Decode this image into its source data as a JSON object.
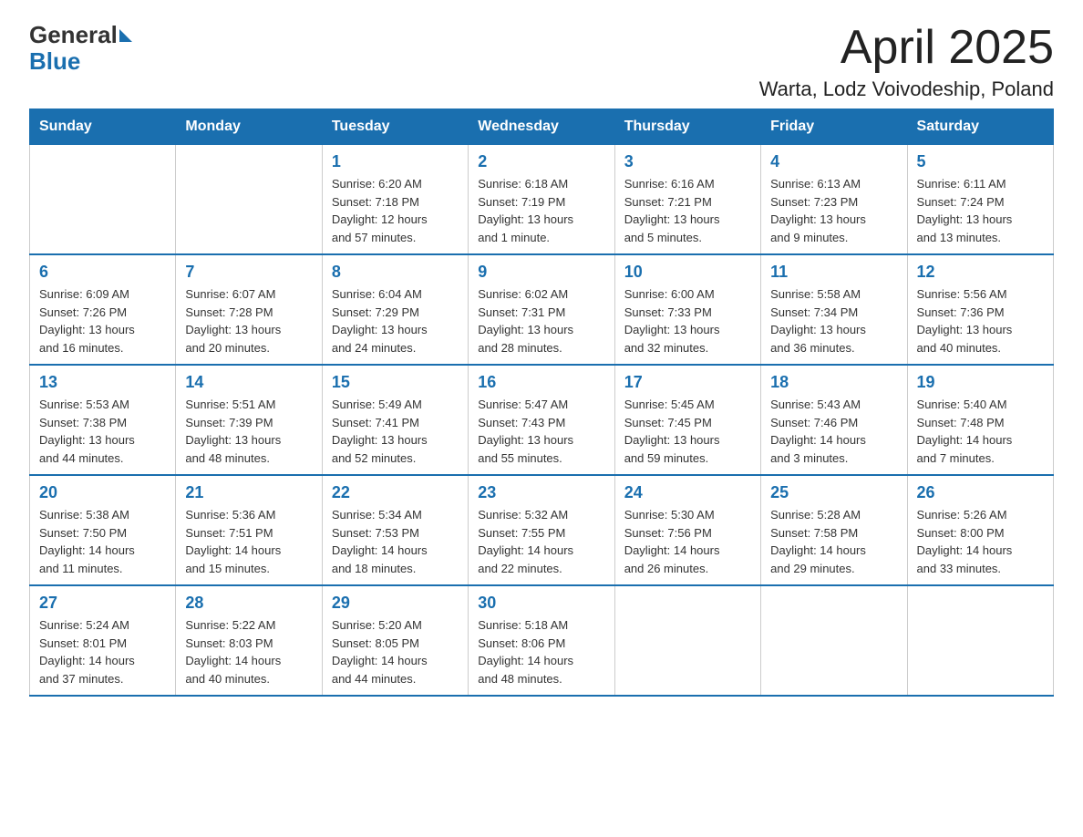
{
  "header": {
    "logo_general": "General",
    "logo_blue": "Blue",
    "title": "April 2025",
    "subtitle": "Warta, Lodz Voivodeship, Poland"
  },
  "weekdays": [
    "Sunday",
    "Monday",
    "Tuesday",
    "Wednesday",
    "Thursday",
    "Friday",
    "Saturday"
  ],
  "weeks": [
    [
      {
        "day": "",
        "info": ""
      },
      {
        "day": "",
        "info": ""
      },
      {
        "day": "1",
        "info": "Sunrise: 6:20 AM\nSunset: 7:18 PM\nDaylight: 12 hours\nand 57 minutes."
      },
      {
        "day": "2",
        "info": "Sunrise: 6:18 AM\nSunset: 7:19 PM\nDaylight: 13 hours\nand 1 minute."
      },
      {
        "day": "3",
        "info": "Sunrise: 6:16 AM\nSunset: 7:21 PM\nDaylight: 13 hours\nand 5 minutes."
      },
      {
        "day": "4",
        "info": "Sunrise: 6:13 AM\nSunset: 7:23 PM\nDaylight: 13 hours\nand 9 minutes."
      },
      {
        "day": "5",
        "info": "Sunrise: 6:11 AM\nSunset: 7:24 PM\nDaylight: 13 hours\nand 13 minutes."
      }
    ],
    [
      {
        "day": "6",
        "info": "Sunrise: 6:09 AM\nSunset: 7:26 PM\nDaylight: 13 hours\nand 16 minutes."
      },
      {
        "day": "7",
        "info": "Sunrise: 6:07 AM\nSunset: 7:28 PM\nDaylight: 13 hours\nand 20 minutes."
      },
      {
        "day": "8",
        "info": "Sunrise: 6:04 AM\nSunset: 7:29 PM\nDaylight: 13 hours\nand 24 minutes."
      },
      {
        "day": "9",
        "info": "Sunrise: 6:02 AM\nSunset: 7:31 PM\nDaylight: 13 hours\nand 28 minutes."
      },
      {
        "day": "10",
        "info": "Sunrise: 6:00 AM\nSunset: 7:33 PM\nDaylight: 13 hours\nand 32 minutes."
      },
      {
        "day": "11",
        "info": "Sunrise: 5:58 AM\nSunset: 7:34 PM\nDaylight: 13 hours\nand 36 minutes."
      },
      {
        "day": "12",
        "info": "Sunrise: 5:56 AM\nSunset: 7:36 PM\nDaylight: 13 hours\nand 40 minutes."
      }
    ],
    [
      {
        "day": "13",
        "info": "Sunrise: 5:53 AM\nSunset: 7:38 PM\nDaylight: 13 hours\nand 44 minutes."
      },
      {
        "day": "14",
        "info": "Sunrise: 5:51 AM\nSunset: 7:39 PM\nDaylight: 13 hours\nand 48 minutes."
      },
      {
        "day": "15",
        "info": "Sunrise: 5:49 AM\nSunset: 7:41 PM\nDaylight: 13 hours\nand 52 minutes."
      },
      {
        "day": "16",
        "info": "Sunrise: 5:47 AM\nSunset: 7:43 PM\nDaylight: 13 hours\nand 55 minutes."
      },
      {
        "day": "17",
        "info": "Sunrise: 5:45 AM\nSunset: 7:45 PM\nDaylight: 13 hours\nand 59 minutes."
      },
      {
        "day": "18",
        "info": "Sunrise: 5:43 AM\nSunset: 7:46 PM\nDaylight: 14 hours\nand 3 minutes."
      },
      {
        "day": "19",
        "info": "Sunrise: 5:40 AM\nSunset: 7:48 PM\nDaylight: 14 hours\nand 7 minutes."
      }
    ],
    [
      {
        "day": "20",
        "info": "Sunrise: 5:38 AM\nSunset: 7:50 PM\nDaylight: 14 hours\nand 11 minutes."
      },
      {
        "day": "21",
        "info": "Sunrise: 5:36 AM\nSunset: 7:51 PM\nDaylight: 14 hours\nand 15 minutes."
      },
      {
        "day": "22",
        "info": "Sunrise: 5:34 AM\nSunset: 7:53 PM\nDaylight: 14 hours\nand 18 minutes."
      },
      {
        "day": "23",
        "info": "Sunrise: 5:32 AM\nSunset: 7:55 PM\nDaylight: 14 hours\nand 22 minutes."
      },
      {
        "day": "24",
        "info": "Sunrise: 5:30 AM\nSunset: 7:56 PM\nDaylight: 14 hours\nand 26 minutes."
      },
      {
        "day": "25",
        "info": "Sunrise: 5:28 AM\nSunset: 7:58 PM\nDaylight: 14 hours\nand 29 minutes."
      },
      {
        "day": "26",
        "info": "Sunrise: 5:26 AM\nSunset: 8:00 PM\nDaylight: 14 hours\nand 33 minutes."
      }
    ],
    [
      {
        "day": "27",
        "info": "Sunrise: 5:24 AM\nSunset: 8:01 PM\nDaylight: 14 hours\nand 37 minutes."
      },
      {
        "day": "28",
        "info": "Sunrise: 5:22 AM\nSunset: 8:03 PM\nDaylight: 14 hours\nand 40 minutes."
      },
      {
        "day": "29",
        "info": "Sunrise: 5:20 AM\nSunset: 8:05 PM\nDaylight: 14 hours\nand 44 minutes."
      },
      {
        "day": "30",
        "info": "Sunrise: 5:18 AM\nSunset: 8:06 PM\nDaylight: 14 hours\nand 48 minutes."
      },
      {
        "day": "",
        "info": ""
      },
      {
        "day": "",
        "info": ""
      },
      {
        "day": "",
        "info": ""
      }
    ]
  ]
}
